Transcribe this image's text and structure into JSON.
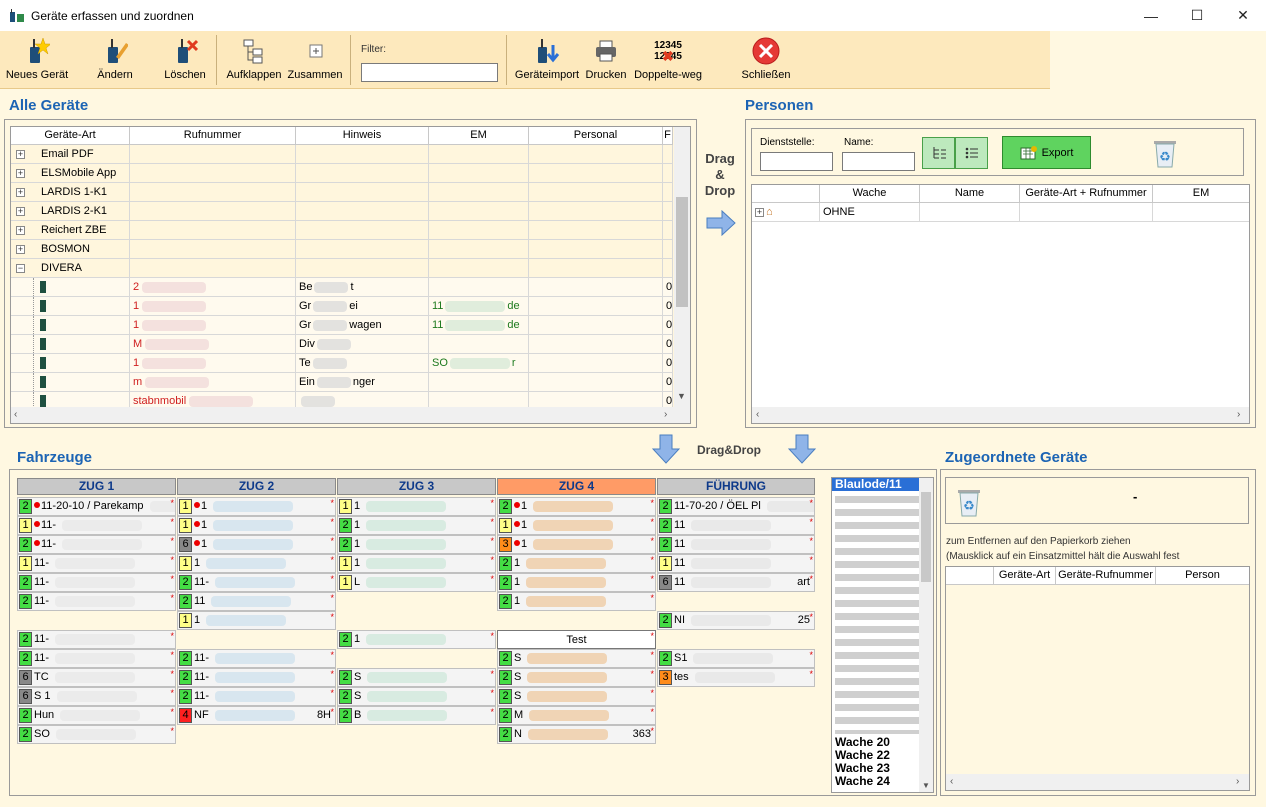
{
  "window": {
    "title": "Geräte erfassen und zuordnen",
    "controls": [
      "—",
      "☐",
      "✕"
    ]
  },
  "toolbar": {
    "neues_geraet": "Neues Gerät",
    "aendern": "Ändern",
    "loeschen": "Löschen",
    "aufklappen": "Aufklappen",
    "zusammen": "Zusammen",
    "filter_label": "Filter:",
    "filter_value": "",
    "geraeteimport": "Geräteimport",
    "drucken": "Drucken",
    "doppelte_weg": "Doppelte-weg",
    "doppelte_icon_text": "12345\n12345",
    "schliessen": "Schließen"
  },
  "alle_geraete": {
    "title": "Alle Geräte",
    "columns": [
      "Geräte-Art",
      "Rufnummer",
      "Hinweis",
      "EM",
      "Personal",
      "F"
    ],
    "groups": [
      {
        "name": "Email PDF",
        "expand": "+"
      },
      {
        "name": "ELSMobile App",
        "expand": "+"
      },
      {
        "name": "LARDIS 1-K1",
        "expand": "+"
      },
      {
        "name": "LARDIS 2-K1",
        "expand": "+"
      },
      {
        "name": "Reichert ZBE",
        "expand": "+"
      },
      {
        "name": "BOSMON",
        "expand": "+"
      },
      {
        "name": "DIVERA",
        "expand": "−"
      }
    ],
    "divera_rows": [
      {
        "ruf": "2",
        "hinweis": "Be",
        "hinweis2": "t",
        "em": "",
        "f": "0"
      },
      {
        "ruf": "1",
        "hinweis": "Gr",
        "hinweis2": "ei",
        "em": "11",
        "em2": "de",
        "f": "0"
      },
      {
        "ruf": "1",
        "hinweis": "Gr",
        "hinweis2": "wagen",
        "em": "11",
        "em2": "de",
        "f": "0"
      },
      {
        "ruf": "M",
        "hinweis": "Div",
        "hinweis2": "",
        "em": "",
        "f": "0"
      },
      {
        "ruf": "1",
        "hinweis": "Te",
        "hinweis2": "",
        "em": "SO",
        "em2": "r",
        "f": "0"
      },
      {
        "ruf": "m",
        "hinweis": "Ein",
        "hinweis2": "nger",
        "em": "",
        "f": "0"
      },
      {
        "ruf": "stabnmobil",
        "hinweis": "",
        "hinweis2": "",
        "em": "",
        "f": "0"
      }
    ]
  },
  "dragdrop": {
    "side": "Drag\n&\nDrop",
    "bottom": "Drag&Drop"
  },
  "personen": {
    "title": "Personen",
    "dienststelle_label": "Dienststelle:",
    "name_label": "Name:",
    "export_label": "Export",
    "columns": [
      "Wache",
      "Name",
      "Geräte-Art + Rufnummer",
      "EM"
    ],
    "rows": [
      {
        "wache": "OHNE"
      }
    ]
  },
  "fahrzeuge": {
    "title": "Fahrzeuge",
    "columns": [
      {
        "name": "ZUG 1"
      },
      {
        "name": "ZUG 2"
      },
      {
        "name": "ZUG 3"
      },
      {
        "name": "ZUG 4"
      },
      {
        "name": "FÜHRUNG"
      }
    ],
    "zug1": [
      {
        "n": "2",
        "t": "11-20-10 / Parekamp"
      },
      {
        "n": "1",
        "t": "11-"
      },
      {
        "n": "2",
        "t": "11-"
      },
      {
        "n": "1",
        "t": "11-"
      },
      {
        "n": "2",
        "t": "11-"
      },
      {
        "n": "2",
        "t": "11-"
      },
      {
        "n": "2",
        "t": "11-"
      },
      {
        "n": "2",
        "t": "11-"
      },
      {
        "n": "6",
        "t": "TC"
      },
      {
        "n": "6",
        "t": "S 1"
      },
      {
        "n": "2",
        "t": "Hun"
      },
      {
        "n": "2",
        "t": "SO"
      }
    ],
    "zug2": [
      {
        "n": "1",
        "t": "1"
      },
      {
        "n": "1",
        "t": "1"
      },
      {
        "n": "6",
        "t": "1"
      },
      {
        "n": "1",
        "t": "1"
      },
      {
        "n": "2",
        "t": "11-"
      },
      {
        "n": "2",
        "t": "11"
      },
      {
        "n": "1",
        "t": "1"
      },
      {
        "n": "2",
        "t": "11-"
      },
      {
        "n": "2",
        "t": "11-"
      },
      {
        "n": "2",
        "t": "11-"
      },
      {
        "n": "4",
        "t": "NF",
        "t2": "8H"
      }
    ],
    "zug3": [
      {
        "n": "1",
        "t": "1"
      },
      {
        "n": "2",
        "t": "1"
      },
      {
        "n": "2",
        "t": "1"
      },
      {
        "n": "1",
        "t": "1"
      },
      {
        "n": "1",
        "t": "L"
      },
      {
        "n": "2",
        "t": "1"
      },
      {
        "n": "2",
        "t": "S"
      },
      {
        "n": "2",
        "t": "S"
      },
      {
        "n": "2",
        "t": "B"
      }
    ],
    "zug4": [
      {
        "n": "2",
        "t": "1"
      },
      {
        "n": "1",
        "t": "1"
      },
      {
        "n": "3",
        "t": "1"
      },
      {
        "n": "2",
        "t": "1"
      },
      {
        "n": "2",
        "t": "1"
      },
      {
        "n": "2",
        "t": "1"
      },
      {
        "n": "",
        "t": "Test"
      },
      {
        "n": "2",
        "t": "S"
      },
      {
        "n": "2",
        "t": "S"
      },
      {
        "n": "2",
        "t": "S"
      },
      {
        "n": "2",
        "t": "M"
      },
      {
        "n": "2",
        "t": "N",
        "t2": "363"
      }
    ],
    "fuehrung": [
      {
        "n": "2",
        "t": "11-70-20 / ÖEL Pl"
      },
      {
        "n": "2",
        "t": "11"
      },
      {
        "n": "2",
        "t": "11"
      },
      {
        "n": "1",
        "t": "11"
      },
      {
        "n": "6",
        "t": "11",
        "t2": "art"
      },
      {
        "n": "2",
        "t": "NI",
        "t2": "25"
      },
      {
        "n": "2",
        "t": "S1"
      },
      {
        "n": "3",
        "t": "tes"
      }
    ],
    "wachen_list": [
      "Blaulode/11",
      "Wache 20",
      "Wache 22",
      "Wache 23",
      "Wache 24"
    ]
  },
  "zugeordnete": {
    "title": "Zugeordnete Geräte",
    "dash": "-",
    "hint1": "zum Entfernen auf den Papierkorb ziehen",
    "hint2": "(Mausklick auf ein Einsatzmittel hält die Auswahl fest",
    "columns": [
      "Geräte-Art",
      "Geräte-Rufnummer",
      "Person"
    ]
  }
}
